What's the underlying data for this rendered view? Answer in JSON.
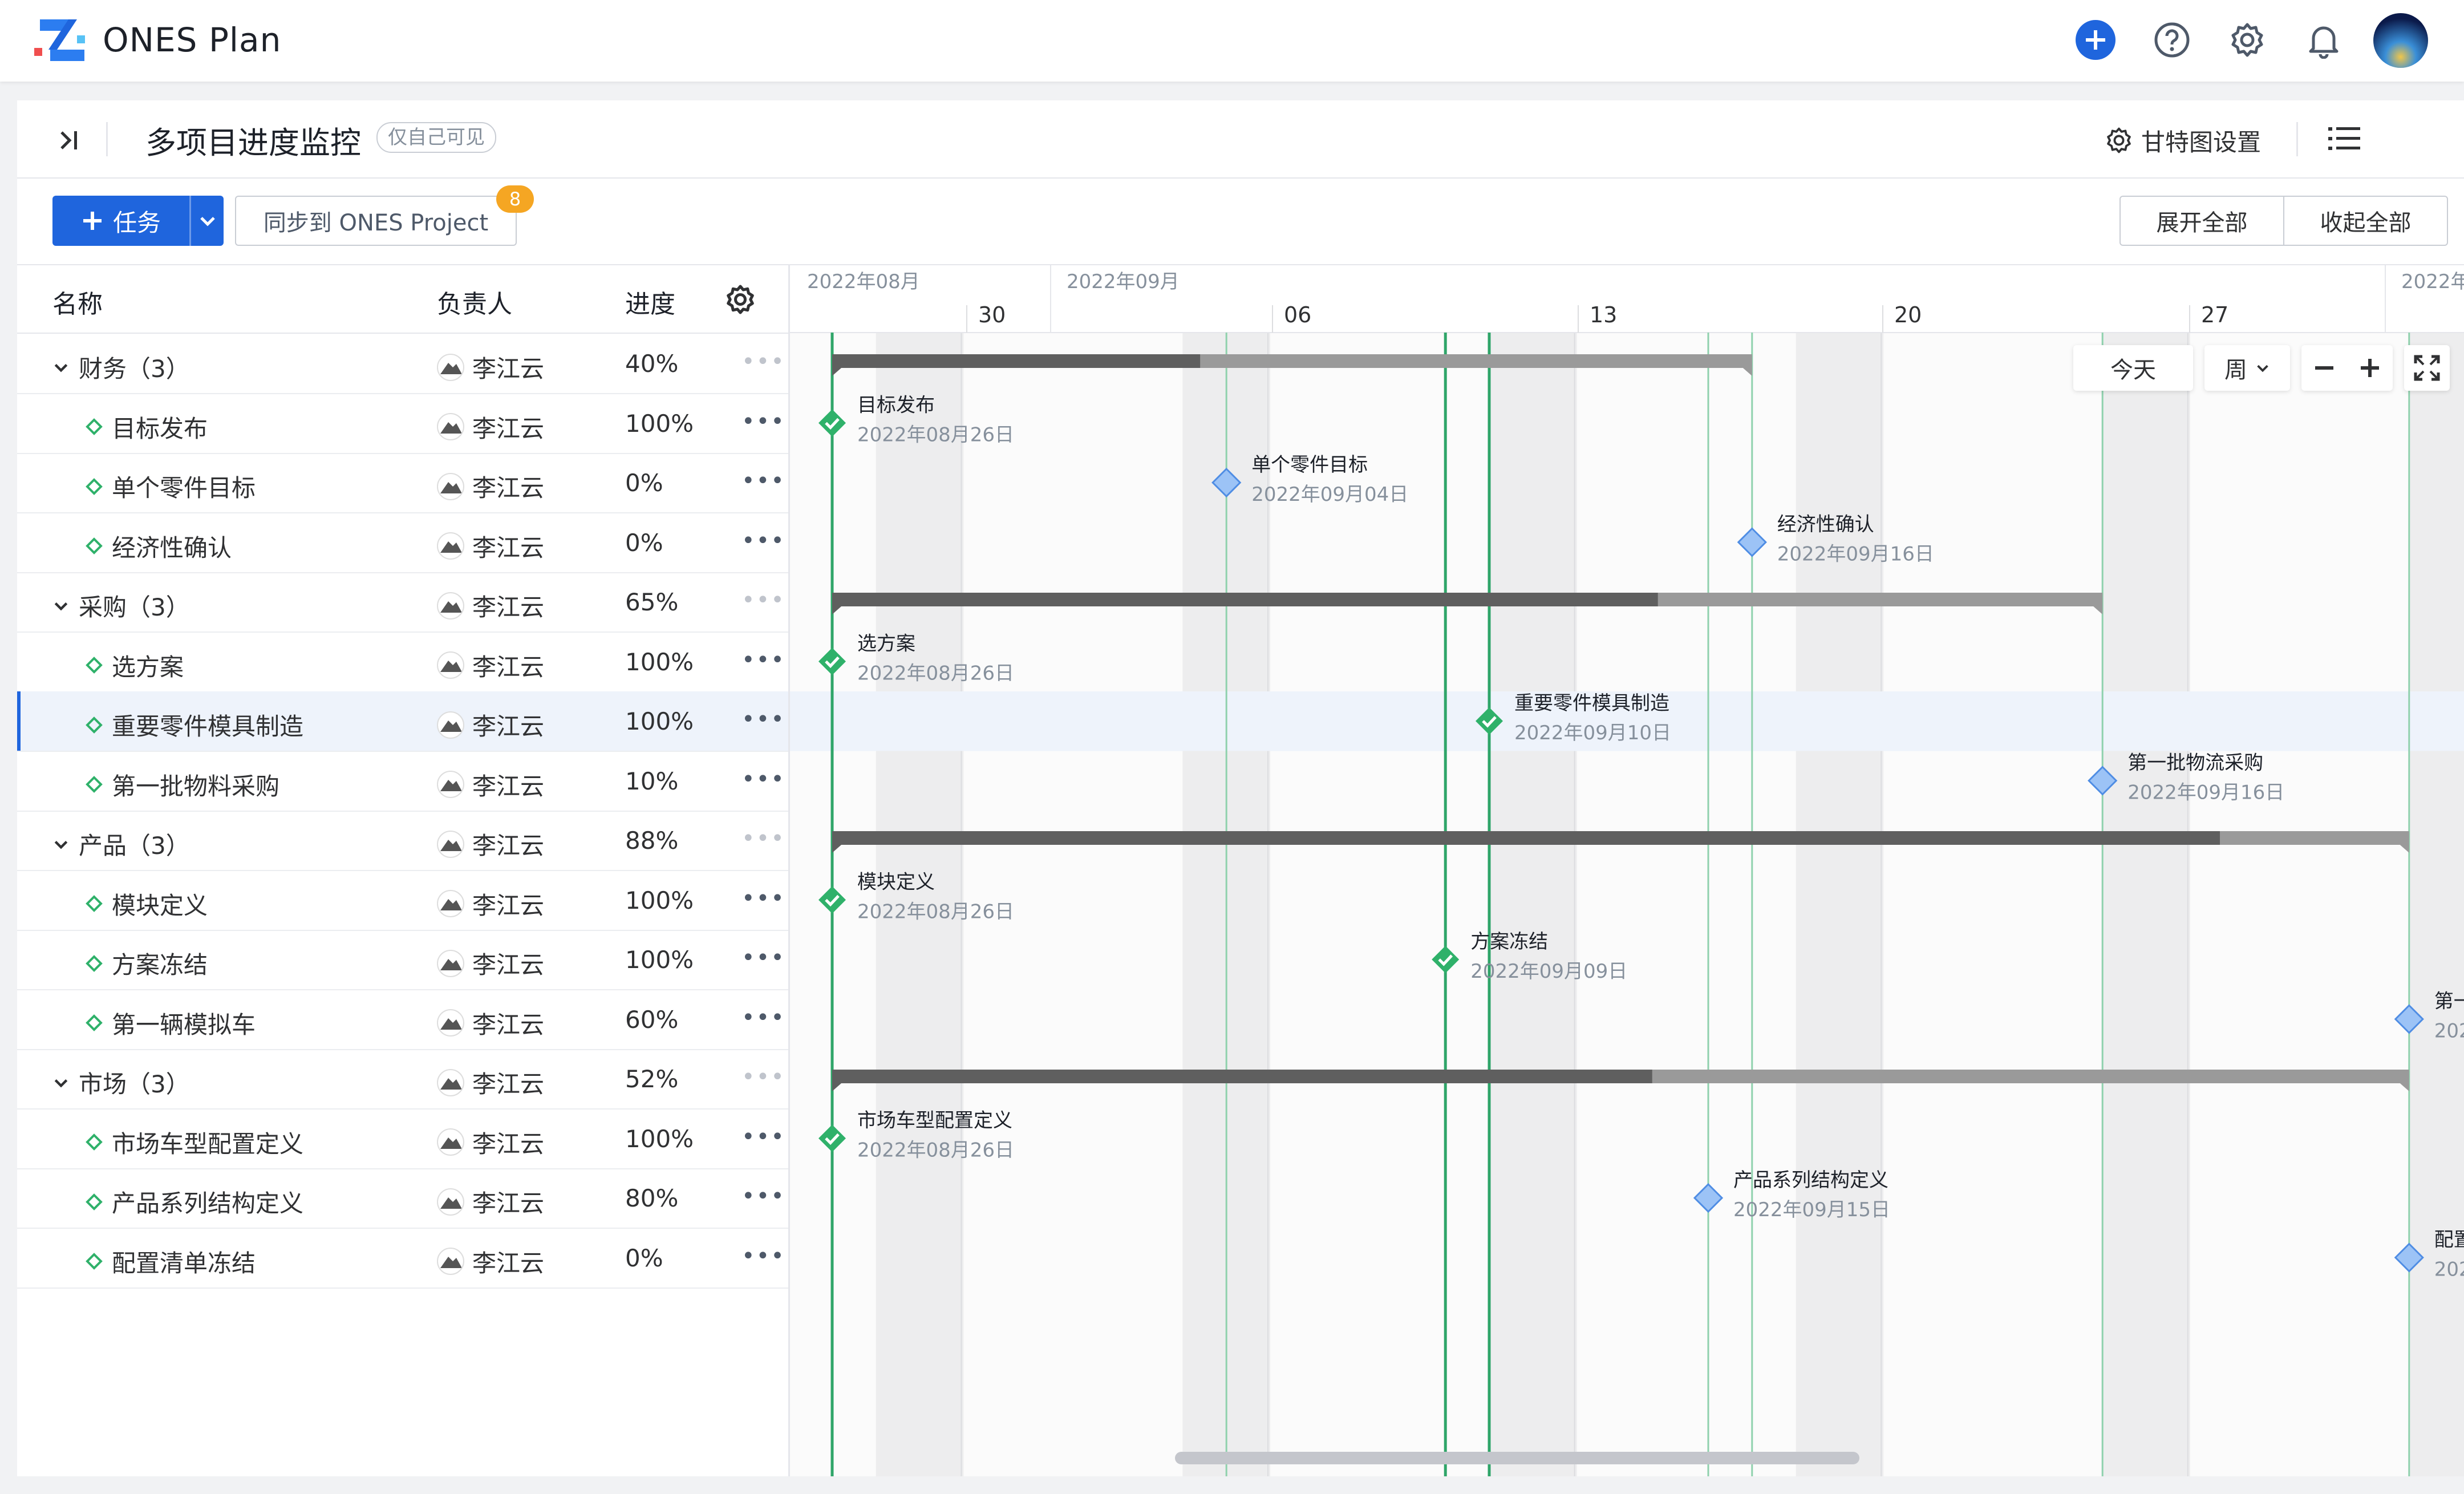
{
  "app": {
    "title": "ONES Plan"
  },
  "header": {
    "page_title": "多项目进度监控",
    "visibility_tag": "仅自己可见",
    "gantt_settings_label": "甘特图设置"
  },
  "toolbar": {
    "task_button": "任务",
    "sync_button": "同步到 ONES Project",
    "sync_badge": "8",
    "expand_all": "展开全部",
    "collapse_all": "收起全部"
  },
  "table": {
    "columns": {
      "name": "名称",
      "owner": "负责人",
      "progress": "进度"
    },
    "rows": [
      {
        "type": "group",
        "name": "财务（3）",
        "owner": "李江云",
        "progress": "40%"
      },
      {
        "type": "item",
        "name": "目标发布",
        "owner": "李江云",
        "progress": "100%"
      },
      {
        "type": "item",
        "name": "单个零件目标",
        "owner": "李江云",
        "progress": "0%"
      },
      {
        "type": "item",
        "name": "经济性确认",
        "owner": "李江云",
        "progress": "0%"
      },
      {
        "type": "group",
        "name": "采购（3）",
        "owner": "李江云",
        "progress": "65%"
      },
      {
        "type": "item",
        "name": "选方案",
        "owner": "李江云",
        "progress": "100%"
      },
      {
        "type": "item",
        "name": "重要零件模具制造",
        "owner": "李江云",
        "progress": "100%",
        "selected": true
      },
      {
        "type": "item",
        "name": "第一批物料采购",
        "owner": "李江云",
        "progress": "10%"
      },
      {
        "type": "group",
        "name": "产品（3）",
        "owner": "李江云",
        "progress": "88%"
      },
      {
        "type": "item",
        "name": "模块定义",
        "owner": "李江云",
        "progress": "100%"
      },
      {
        "type": "item",
        "name": "方案冻结",
        "owner": "李江云",
        "progress": "100%"
      },
      {
        "type": "item",
        "name": "第一辆模拟车",
        "owner": "李江云",
        "progress": "60%"
      },
      {
        "type": "group",
        "name": "市场（3）",
        "owner": "李江云",
        "progress": "52%"
      },
      {
        "type": "item",
        "name": "市场车型配置定义",
        "owner": "李江云",
        "progress": "100%"
      },
      {
        "type": "item",
        "name": "产品系列结构定义",
        "owner": "李江云",
        "progress": "80%"
      },
      {
        "type": "item",
        "name": "配置清单冻结",
        "owner": "李江云",
        "progress": "0%"
      }
    ],
    "more_glyph": "•••"
  },
  "gantt": {
    "months": [
      "2022年08月",
      "2022年09月",
      "2022年"
    ],
    "weeks": [
      "30",
      "06",
      "13",
      "20",
      "27"
    ],
    "controls": {
      "today": "今天",
      "scale": "周"
    },
    "groups": [
      {
        "progress": 0.4,
        "start": "2022-08-26",
        "end": "2022-09-16"
      },
      {
        "progress": 0.65,
        "start": "2022-08-26",
        "end": "2022-09-24"
      },
      {
        "progress": 0.88,
        "start": "2022-08-26",
        "end": "2022-10-01"
      },
      {
        "progress": 0.52,
        "start": "2022-08-26",
        "end": "2022-10-01"
      }
    ],
    "milestones": [
      {
        "label": "目标发布",
        "date": "2022年08月26日",
        "done": true
      },
      {
        "label": "单个零件目标",
        "date": "2022年09月04日",
        "done": false
      },
      {
        "label": "经济性确认",
        "date": "2022年09月16日",
        "done": false
      },
      {
        "label": "选方案",
        "date": "2022年08月26日",
        "done": true
      },
      {
        "label": "重要零件模具制造",
        "date": "2022年09月10日",
        "done": true
      },
      {
        "label": "第一批物流采购",
        "date": "2022年09月16日",
        "done": false
      },
      {
        "label": "模块定义",
        "date": "2022年08月26日",
        "done": true
      },
      {
        "label": "方案冻结",
        "date": "2022年09月09日",
        "done": true
      },
      {
        "label": "第一",
        "date": "202",
        "done": false
      },
      {
        "label": "市场车型配置定义",
        "date": "2022年08月26日",
        "done": true
      },
      {
        "label": "产品系列结构定义",
        "date": "2022年09月15日",
        "done": false
      },
      {
        "label": "配置",
        "date": "202",
        "done": false
      }
    ]
  },
  "colors": {
    "accent": "#1f65dd",
    "done": "#2fb16a",
    "pending": "#9cc3f6"
  }
}
